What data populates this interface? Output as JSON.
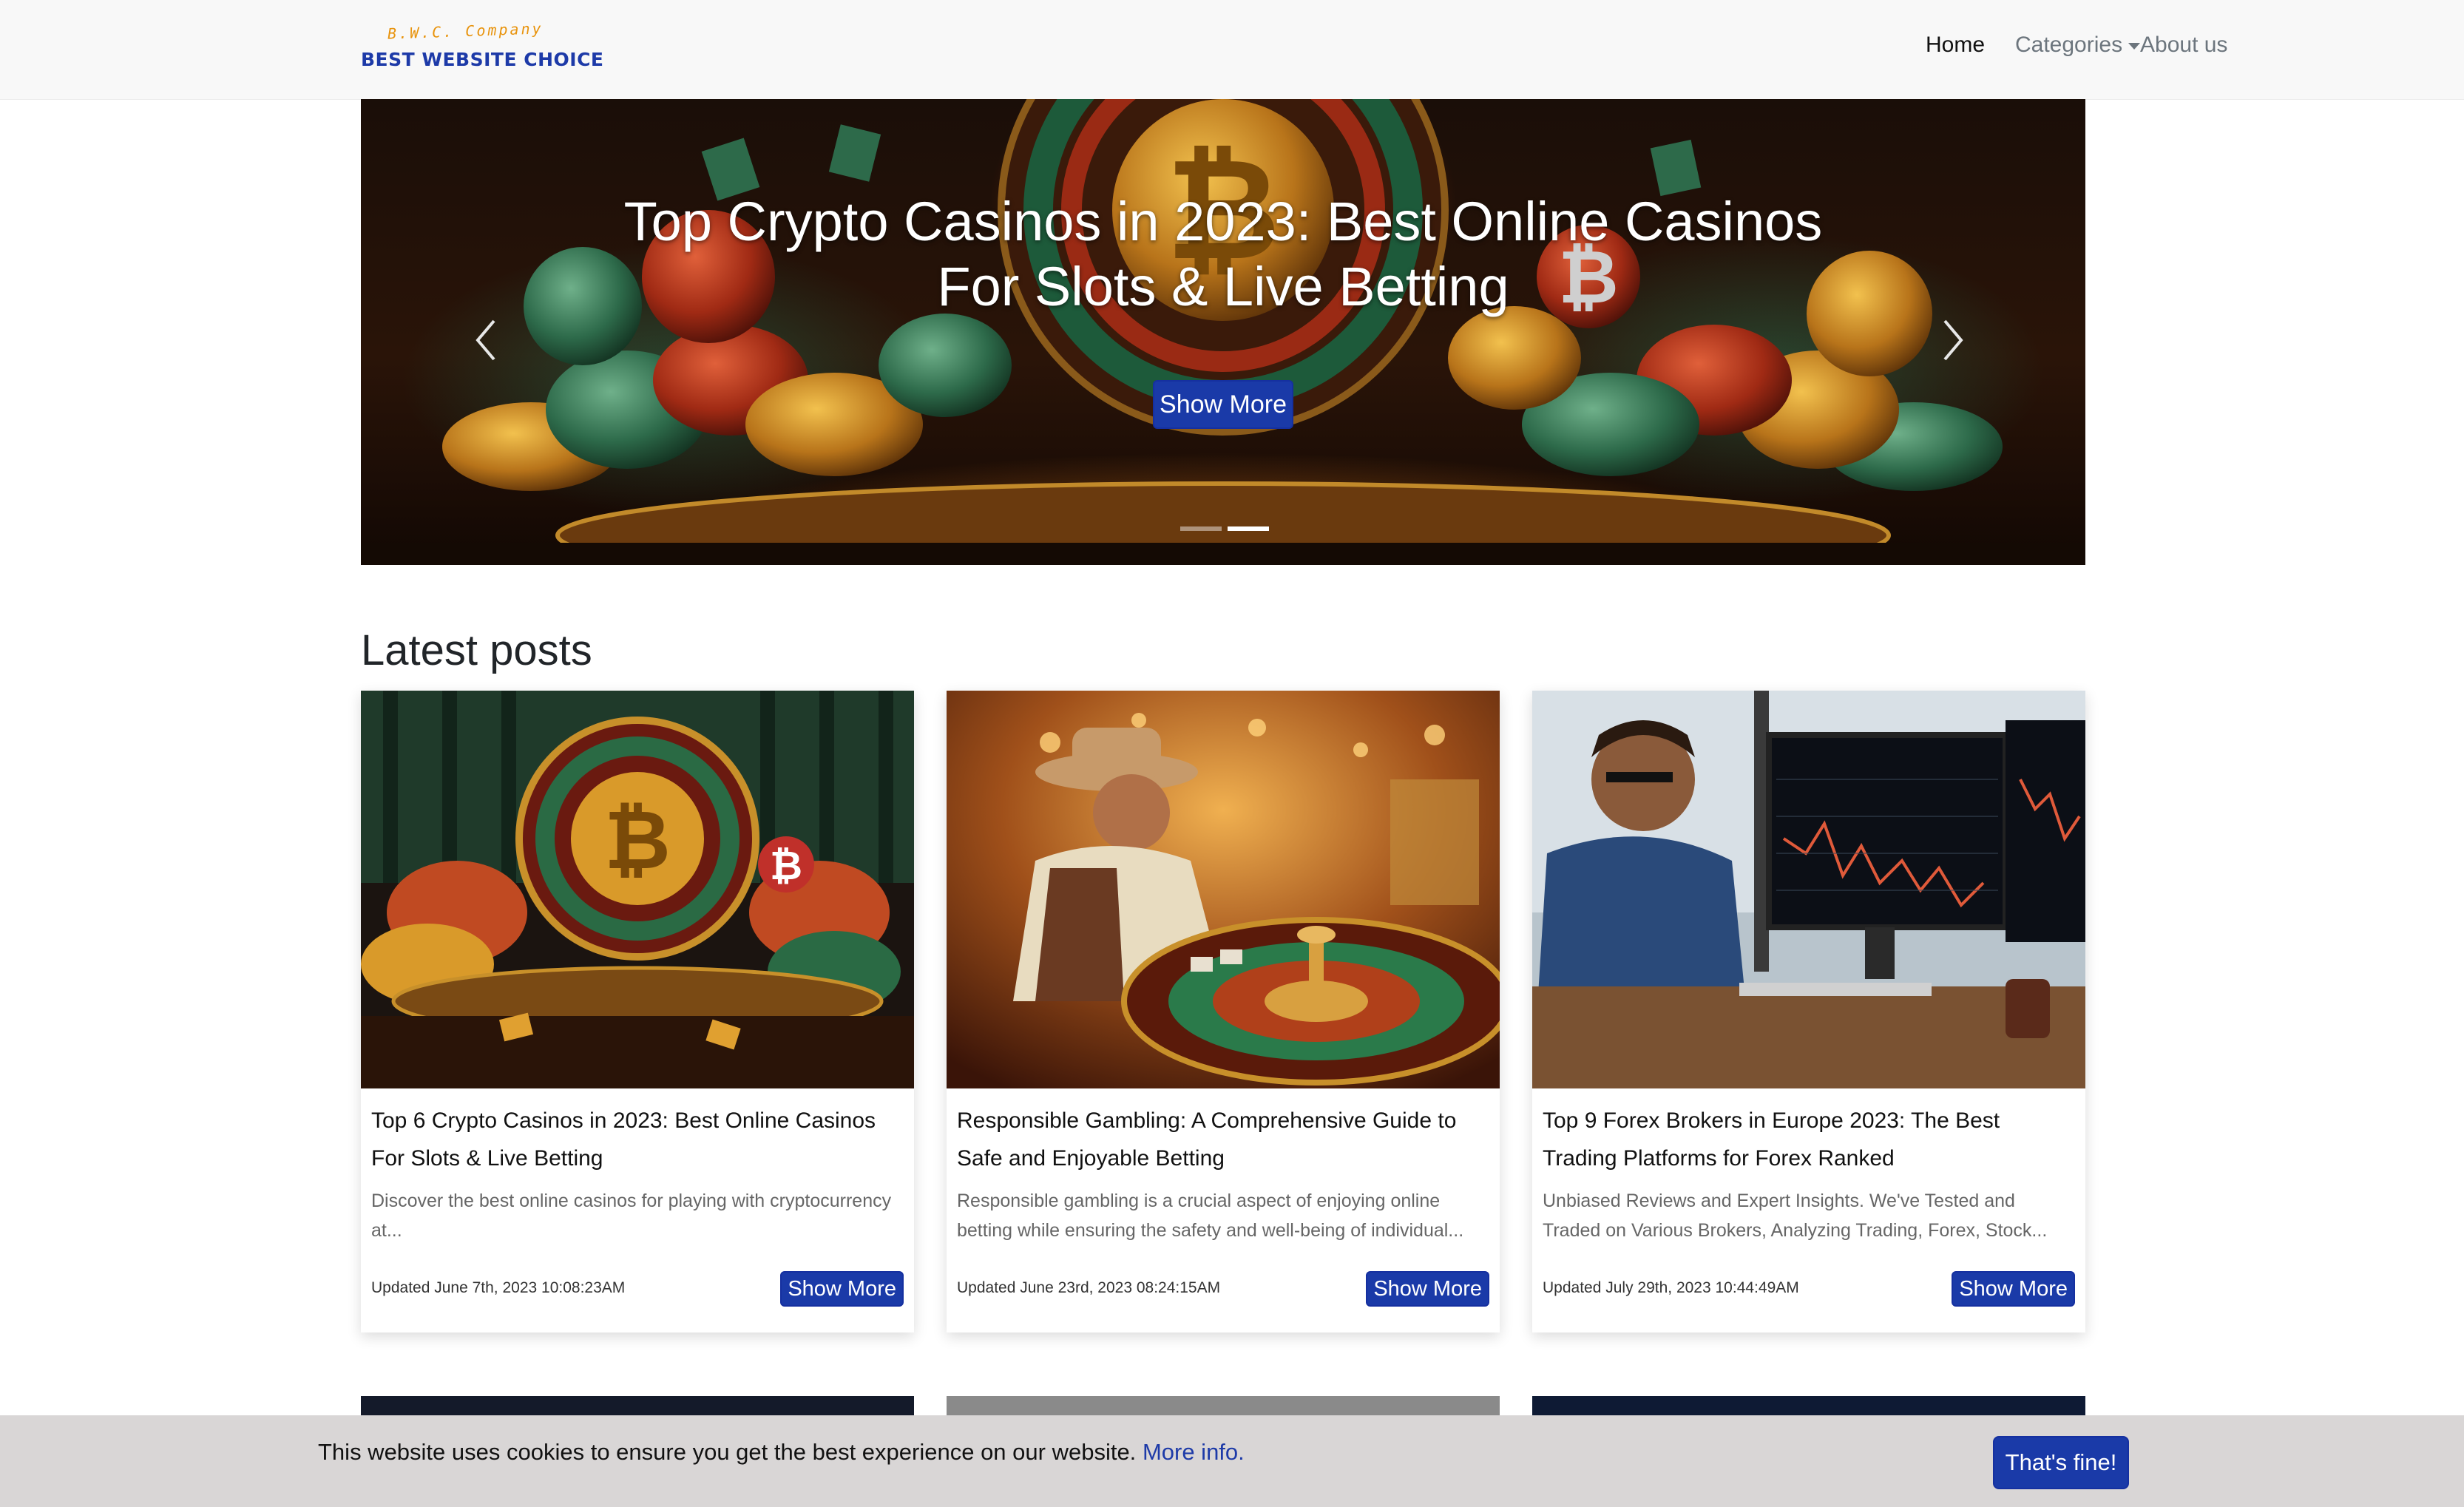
{
  "brand": {
    "tagline": "B.W.C. Company",
    "name": "BEST WEBSITE CHOICE"
  },
  "nav": {
    "home": "Home",
    "categories": "Categories",
    "about": "About us"
  },
  "hero": {
    "title": "Top Crypto Casinos in 2023: Best Online Casinos For Slots & Live Betting",
    "button": "Show More",
    "prev_icon": "chevron-left-icon",
    "next_icon": "chevron-right-icon",
    "slide_count": 2,
    "active_slide": 2
  },
  "latest": {
    "heading": "Latest posts",
    "cards": [
      {
        "title": "Top 6 Crypto Casinos in 2023: Best Online Casinos For Slots & Live Betting",
        "excerpt": "Discover the best online casinos for playing with cryptocurrency at...",
        "updated": "Updated June 7th, 2023 10:08:23AM",
        "button": "Show More"
      },
      {
        "title": "Responsible Gambling: A Comprehensive Guide to Safe and Enjoyable Betting",
        "excerpt": "Responsible gambling is a crucial aspect of enjoying online betting while ensuring the safety and well-being of individual...",
        "updated": "Updated June 23rd, 2023 08:24:15AM",
        "button": "Show More"
      },
      {
        "title": "Top 9 Forex Brokers in Europe 2023: The Best Trading Platforms for Forex Ranked",
        "excerpt": "Unbiased Reviews and Expert Insights. We've Tested and Traded on Various Brokers, Analyzing Trading, Forex, Stock...",
        "updated": "Updated July 29th, 2023 10:44:49AM",
        "button": "Show More"
      }
    ]
  },
  "cookie": {
    "text": "This website uses cookies to ensure you get the best experience on our website.",
    "link": "More info.",
    "button": "That's fine!"
  },
  "colors": {
    "accent": "#1a3aa8",
    "brand_orange": "#e8930c",
    "navbar_bg": "#f8f8f8",
    "cookie_bg": "#d9d6d6"
  }
}
